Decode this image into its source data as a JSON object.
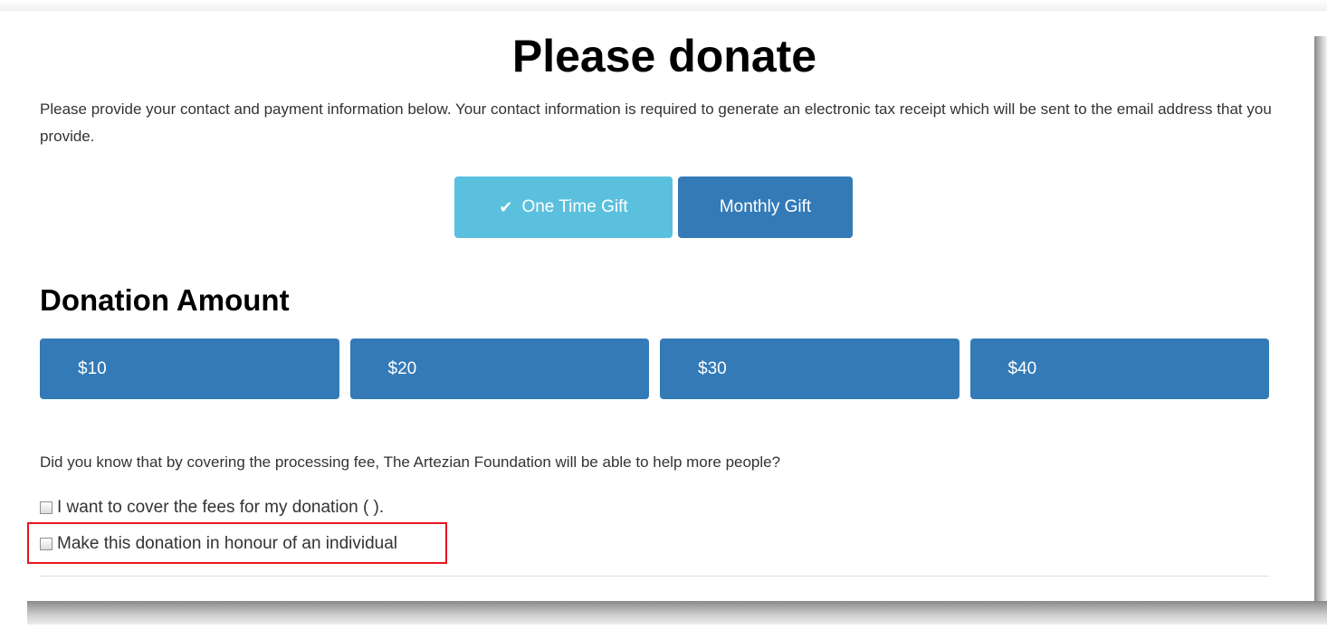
{
  "page": {
    "title": "Please donate",
    "intro": "Please provide your contact and payment information below. Your contact information is required to generate an electronic tax receipt which will be sent to the email address that you provide."
  },
  "gift_type": {
    "options": [
      {
        "label": "One Time Gift",
        "selected": true,
        "color": "#5bc0de"
      },
      {
        "label": "Monthly Gift",
        "selected": false,
        "color": "#337ab7"
      }
    ],
    "selected_icon": "check-icon"
  },
  "donation": {
    "heading": "Donation Amount",
    "amounts": [
      "$10",
      "$20",
      "$30",
      "$40"
    ],
    "button_color": "#337ab7"
  },
  "fees": {
    "question": "Did you know that by covering the processing fee, The Artezian Foundation will be able to help more people?",
    "cover_fees_label": "I want to cover the fees for my donation ( ).",
    "cover_fees_checked": false,
    "honour_label": "Make this donation in honour of an individual",
    "honour_checked": false,
    "highlight_color": "#e8141f"
  }
}
